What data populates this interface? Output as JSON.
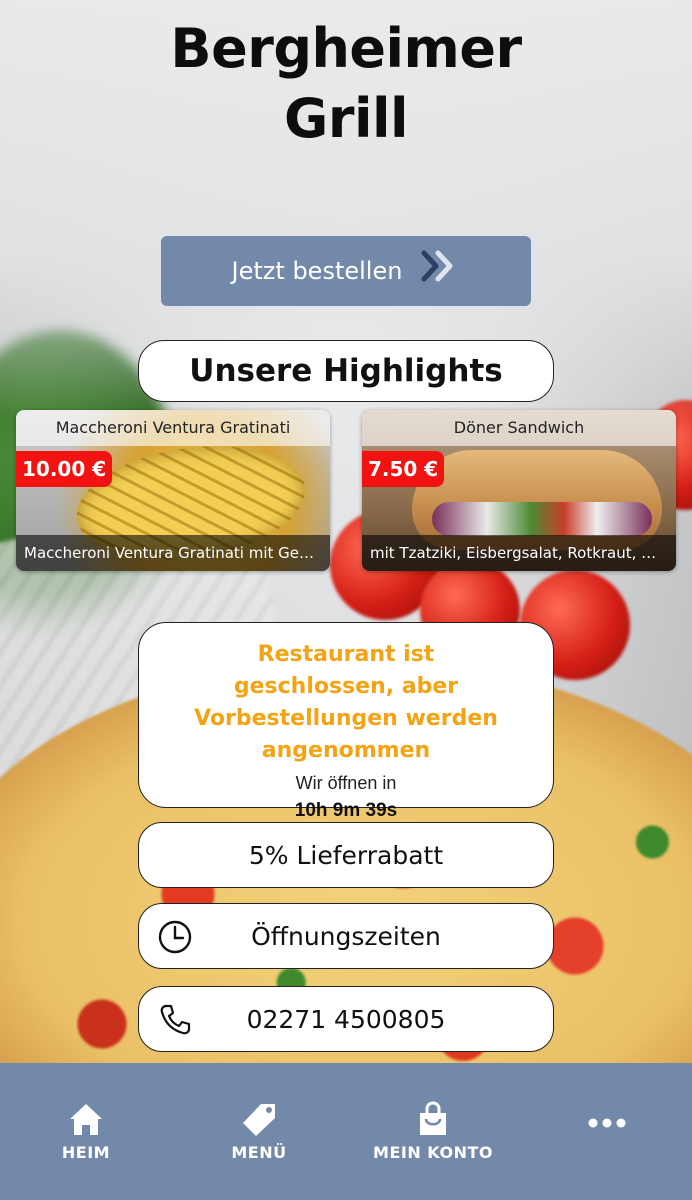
{
  "header": {
    "title_line1": "Bergheimer",
    "title_line2": "Grill"
  },
  "order_button": {
    "label": "Jetzt bestellen",
    "icon": "double-chevron-right-icon"
  },
  "highlights": {
    "title": "Unsere Highlights",
    "items": [
      {
        "name": "Maccheroni Ventura Gratinati",
        "price": "10.00 €",
        "description": "Maccheroni Ventura Gratinati mit Gemüse"
      },
      {
        "name": "Döner Sandwich",
        "price": "7.50 €",
        "description": "mit Tzatziki, Eisbergsalat, Rotkraut, Weiß..."
      }
    ]
  },
  "status": {
    "message": "Restaurant ist geschlossen, aber Vorbestellungen werden angenommen",
    "opens_in_label": "Wir öffnen in",
    "countdown": "10h 9m 39s"
  },
  "info_buttons": {
    "discount": "5% Lieferrabatt",
    "hours": "Öffnungszeiten",
    "phone": "02271 4500805"
  },
  "bottom_nav": [
    {
      "label": "HEIM",
      "icon": "home-icon"
    },
    {
      "label": "MENÜ",
      "icon": "price-tag-icon"
    },
    {
      "label": "MEIN KONTO",
      "icon": "shopping-bag-icon"
    },
    {
      "label": "",
      "icon": "more-dots-icon"
    }
  ],
  "colors": {
    "accent": "#7389aa",
    "price_badge": "#f21212",
    "status_text": "#f2a414"
  }
}
